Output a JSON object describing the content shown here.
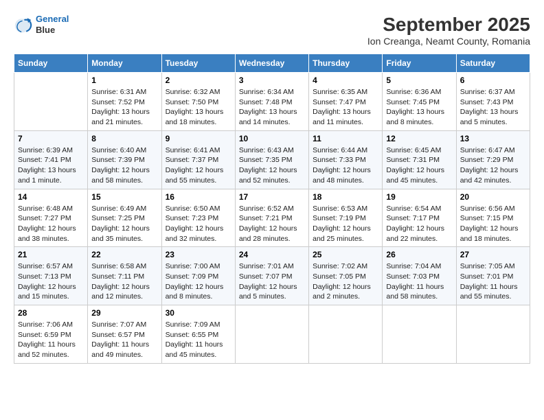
{
  "header": {
    "logo_line1": "General",
    "logo_line2": "Blue",
    "title": "September 2025",
    "subtitle": "Ion Creanga, Neamt County, Romania"
  },
  "weekdays": [
    "Sunday",
    "Monday",
    "Tuesday",
    "Wednesday",
    "Thursday",
    "Friday",
    "Saturday"
  ],
  "weeks": [
    [
      {
        "day": "",
        "detail": ""
      },
      {
        "day": "1",
        "detail": "Sunrise: 6:31 AM\nSunset: 7:52 PM\nDaylight: 13 hours\nand 21 minutes."
      },
      {
        "day": "2",
        "detail": "Sunrise: 6:32 AM\nSunset: 7:50 PM\nDaylight: 13 hours\nand 18 minutes."
      },
      {
        "day": "3",
        "detail": "Sunrise: 6:34 AM\nSunset: 7:48 PM\nDaylight: 13 hours\nand 14 minutes."
      },
      {
        "day": "4",
        "detail": "Sunrise: 6:35 AM\nSunset: 7:47 PM\nDaylight: 13 hours\nand 11 minutes."
      },
      {
        "day": "5",
        "detail": "Sunrise: 6:36 AM\nSunset: 7:45 PM\nDaylight: 13 hours\nand 8 minutes."
      },
      {
        "day": "6",
        "detail": "Sunrise: 6:37 AM\nSunset: 7:43 PM\nDaylight: 13 hours\nand 5 minutes."
      }
    ],
    [
      {
        "day": "7",
        "detail": "Sunrise: 6:39 AM\nSunset: 7:41 PM\nDaylight: 13 hours\nand 1 minute."
      },
      {
        "day": "8",
        "detail": "Sunrise: 6:40 AM\nSunset: 7:39 PM\nDaylight: 12 hours\nand 58 minutes."
      },
      {
        "day": "9",
        "detail": "Sunrise: 6:41 AM\nSunset: 7:37 PM\nDaylight: 12 hours\nand 55 minutes."
      },
      {
        "day": "10",
        "detail": "Sunrise: 6:43 AM\nSunset: 7:35 PM\nDaylight: 12 hours\nand 52 minutes."
      },
      {
        "day": "11",
        "detail": "Sunrise: 6:44 AM\nSunset: 7:33 PM\nDaylight: 12 hours\nand 48 minutes."
      },
      {
        "day": "12",
        "detail": "Sunrise: 6:45 AM\nSunset: 7:31 PM\nDaylight: 12 hours\nand 45 minutes."
      },
      {
        "day": "13",
        "detail": "Sunrise: 6:47 AM\nSunset: 7:29 PM\nDaylight: 12 hours\nand 42 minutes."
      }
    ],
    [
      {
        "day": "14",
        "detail": "Sunrise: 6:48 AM\nSunset: 7:27 PM\nDaylight: 12 hours\nand 38 minutes."
      },
      {
        "day": "15",
        "detail": "Sunrise: 6:49 AM\nSunset: 7:25 PM\nDaylight: 12 hours\nand 35 minutes."
      },
      {
        "day": "16",
        "detail": "Sunrise: 6:50 AM\nSunset: 7:23 PM\nDaylight: 12 hours\nand 32 minutes."
      },
      {
        "day": "17",
        "detail": "Sunrise: 6:52 AM\nSunset: 7:21 PM\nDaylight: 12 hours\nand 28 minutes."
      },
      {
        "day": "18",
        "detail": "Sunrise: 6:53 AM\nSunset: 7:19 PM\nDaylight: 12 hours\nand 25 minutes."
      },
      {
        "day": "19",
        "detail": "Sunrise: 6:54 AM\nSunset: 7:17 PM\nDaylight: 12 hours\nand 22 minutes."
      },
      {
        "day": "20",
        "detail": "Sunrise: 6:56 AM\nSunset: 7:15 PM\nDaylight: 12 hours\nand 18 minutes."
      }
    ],
    [
      {
        "day": "21",
        "detail": "Sunrise: 6:57 AM\nSunset: 7:13 PM\nDaylight: 12 hours\nand 15 minutes."
      },
      {
        "day": "22",
        "detail": "Sunrise: 6:58 AM\nSunset: 7:11 PM\nDaylight: 12 hours\nand 12 minutes."
      },
      {
        "day": "23",
        "detail": "Sunrise: 7:00 AM\nSunset: 7:09 PM\nDaylight: 12 hours\nand 8 minutes."
      },
      {
        "day": "24",
        "detail": "Sunrise: 7:01 AM\nSunset: 7:07 PM\nDaylight: 12 hours\nand 5 minutes."
      },
      {
        "day": "25",
        "detail": "Sunrise: 7:02 AM\nSunset: 7:05 PM\nDaylight: 12 hours\nand 2 minutes."
      },
      {
        "day": "26",
        "detail": "Sunrise: 7:04 AM\nSunset: 7:03 PM\nDaylight: 11 hours\nand 58 minutes."
      },
      {
        "day": "27",
        "detail": "Sunrise: 7:05 AM\nSunset: 7:01 PM\nDaylight: 11 hours\nand 55 minutes."
      }
    ],
    [
      {
        "day": "28",
        "detail": "Sunrise: 7:06 AM\nSunset: 6:59 PM\nDaylight: 11 hours\nand 52 minutes."
      },
      {
        "day": "29",
        "detail": "Sunrise: 7:07 AM\nSunset: 6:57 PM\nDaylight: 11 hours\nand 49 minutes."
      },
      {
        "day": "30",
        "detail": "Sunrise: 7:09 AM\nSunset: 6:55 PM\nDaylight: 11 hours\nand 45 minutes."
      },
      {
        "day": "",
        "detail": ""
      },
      {
        "day": "",
        "detail": ""
      },
      {
        "day": "",
        "detail": ""
      },
      {
        "day": "",
        "detail": ""
      }
    ]
  ]
}
